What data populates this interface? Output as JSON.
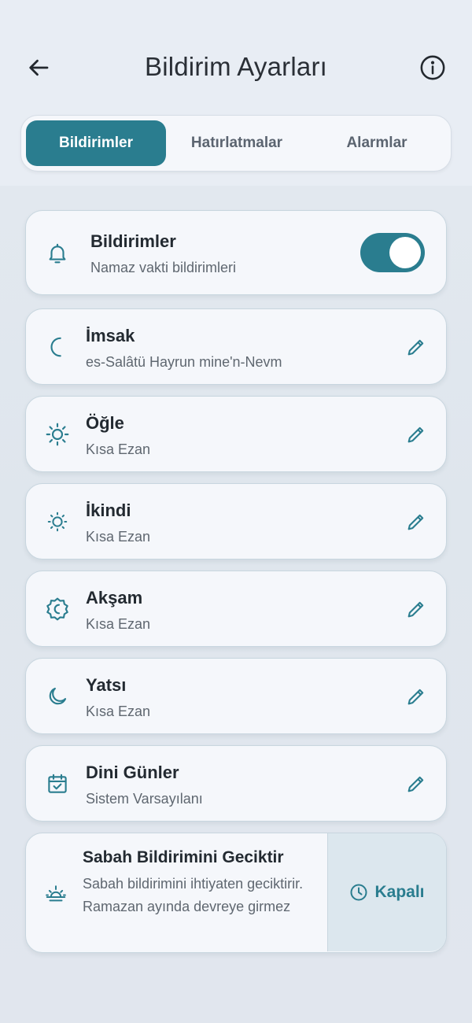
{
  "header": {
    "title": "Bildirim Ayarları",
    "back_icon": "arrow-left-icon",
    "info_icon": "info-icon"
  },
  "tabs": [
    {
      "label": "Bildirimler",
      "active": true
    },
    {
      "label": "Hatırlatmalar",
      "active": false
    },
    {
      "label": "Alarmlar",
      "active": false
    }
  ],
  "master": {
    "title": "Bildirimler",
    "subtitle": "Namaz vakti bildirimleri",
    "enabled": true,
    "icon": "bell-icon"
  },
  "prayers": [
    {
      "title": "İmsak",
      "subtitle": "es-Salâtü Hayrun mine'n-Nevm",
      "icon": "crescent-icon"
    },
    {
      "title": "Öğle",
      "subtitle": "Kısa Ezan",
      "icon": "sun-icon"
    },
    {
      "title": "İkindi",
      "subtitle": "Kısa Ezan",
      "icon": "sun-small-icon"
    },
    {
      "title": "Akşam",
      "subtitle": "Kısa Ezan",
      "icon": "sunset-badge-icon"
    },
    {
      "title": "Yatsı",
      "subtitle": "Kısa Ezan",
      "icon": "moon-icon"
    },
    {
      "title": "Dini Günler",
      "subtitle": "Sistem Varsayılanı",
      "icon": "calendar-check-icon"
    }
  ],
  "delay": {
    "title": "Sabah Bildirimini Geciktir",
    "description": "Sabah bildirimini ihtiyaten geciktirir. Ramazan ayında devreye girmez",
    "status": "Kapalı",
    "icon": "sunrise-icon",
    "status_icon": "clock-icon"
  },
  "colors": {
    "accent": "#2a7d8f",
    "card_bg": "#f5f7fb",
    "side_bg": "#dce7ee"
  }
}
